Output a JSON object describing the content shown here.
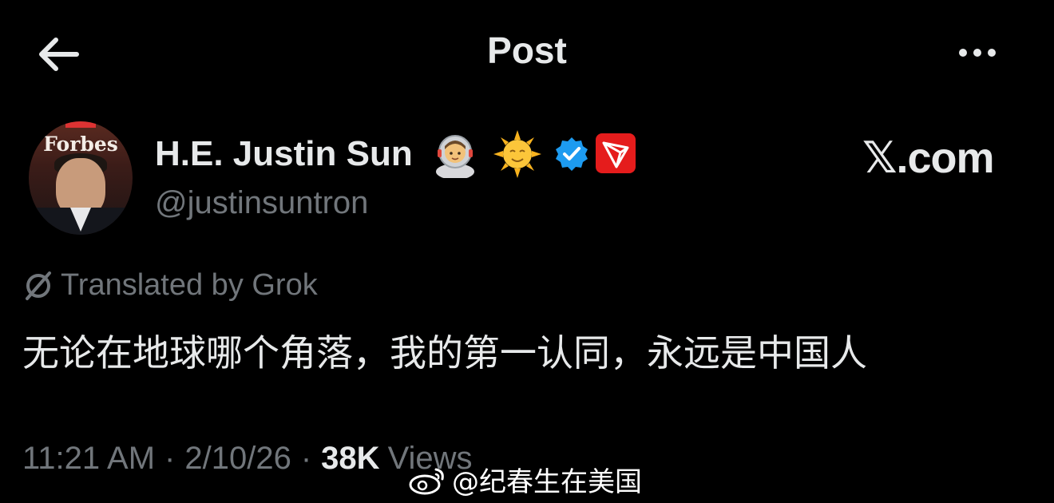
{
  "header": {
    "title": "Post",
    "back_icon": "arrow-left-icon",
    "more_icon": "ellipsis-icon"
  },
  "author": {
    "display_name": "H.E. Justin Sun",
    "handle": "@justinsuntron",
    "avatar_text": "Forbes",
    "name_emojis": [
      "astronaut-icon",
      "sun-with-face-icon"
    ],
    "verified_icon": "verified-badge-icon",
    "affiliate_icon": "tron-logo-icon"
  },
  "brand": {
    "site_label": "𝕏.com"
  },
  "translation": {
    "label": "Translated by Grok",
    "icon": "grok-icon"
  },
  "post": {
    "text": "无论在地球哪个角落，我的第一认同，永远是中国人"
  },
  "meta": {
    "time": "11:21 AM",
    "separator": "·",
    "date": "2/10/26",
    "views_count": "38K",
    "views_label": "Views"
  },
  "watermark": {
    "text": "@纪春生在美国",
    "icon": "weibo-icon"
  },
  "colors": {
    "background": "#000000",
    "primary_text": "#e7e9ea",
    "secondary_text": "#71767b",
    "verified_blue": "#1d9bf0",
    "tron_red": "#e51c1c"
  }
}
